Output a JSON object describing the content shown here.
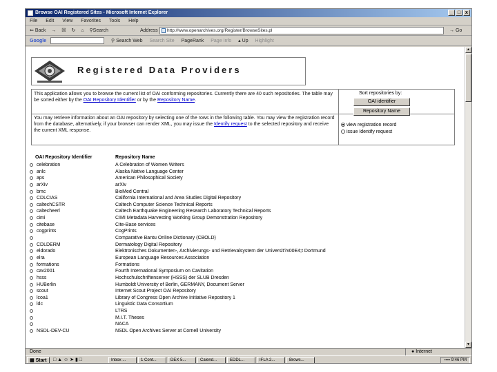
{
  "window": {
    "title": "Browse OAI Registered Sites - Microsoft Internet Explorer",
    "controls": [
      "_",
      "□",
      "x"
    ]
  },
  "menu": [
    "File",
    "Edit",
    "View",
    "Favorites",
    "Tools",
    "Help"
  ],
  "toolbar": {
    "back": "Back",
    "search": "Search",
    "address_label": "Address",
    "url": "http://www.openarchives.org/Register/BrowseSites.pl",
    "go": "Go"
  },
  "googlebar": {
    "logo": "Google",
    "search_web": "Search Web",
    "search_site": "Search Site",
    "pagerank": "PageRank",
    "page_info": "Page Info",
    "up": "Up",
    "highlight": "Highlight"
  },
  "page": {
    "title": "Registered Data Providers",
    "intro_pre": "This application allows you to browse the current list of OAI conforming repositories. Currently there are 40 such repositories. The table may be sorted either by the",
    "intro_link1": "OAI Repository Identifier",
    "intro_mid": "or by the",
    "intro_link2": "Repository Name",
    "intro_post": ".",
    "sort_label": "Sort repositories by:",
    "sort_btn1": "OAI identifier",
    "sort_btn2": "Repository Name",
    "retrieve_pre": "You may retrieve information about an OAI repository by selecting one of the rows in the following table. You may view the registration record from the database, alternatively, if your browser can render XML, you may issue the",
    "retrieve_link": "Identify request",
    "retrieve_post": "to the selected repository and receive the current XML response.",
    "opt_view": "view registration record",
    "opt_identify": "issue Identify request",
    "col_id": "OAI Repository Identifier",
    "col_name": "Repository Name"
  },
  "repositories": [
    {
      "id": "celebration",
      "name": "A Celebration of Women Writers"
    },
    {
      "id": "anlc",
      "name": "Alaska Native Language Center"
    },
    {
      "id": "aps",
      "name": "American Philosophical Society"
    },
    {
      "id": "arXiv",
      "name": "arXiv"
    },
    {
      "id": "bmc",
      "name": "BioMed Central"
    },
    {
      "id": "CDLCIAS",
      "name": "California International and Area Studies Digital Repository"
    },
    {
      "id": "caltechCSTR",
      "name": "Caltech Computer Science Technical Reports"
    },
    {
      "id": "caltecheerl",
      "name": "Caltech Earthquake Engineering Research Laboratory Technical Reports"
    },
    {
      "id": "cimi",
      "name": "CIMI Metadata Harvesting Working Group Demonstration Repository"
    },
    {
      "id": "citebase",
      "name": "Cite-Base services"
    },
    {
      "id": "cogprints",
      "name": "CogPrints"
    },
    {
      "id": "",
      "name": "Comparative Bantu Online Dictionary (CBOLD)"
    },
    {
      "id": "CDLDERM",
      "name": "Dermatology Digital Repository"
    },
    {
      "id": "eldorado",
      "name": "Elektronisches Dokumenten-, Archivierungs- und Retrievalsystem der Universit?x00E4;t Dortmund"
    },
    {
      "id": "elra",
      "name": "European Language Resources Association"
    },
    {
      "id": "formations",
      "name": "Formations"
    },
    {
      "id": "cav2001",
      "name": "Fourth International Symposium on Cavitation"
    },
    {
      "id": "hsss",
      "name": "Hochschulschriftenserver (HSSS) der SLUB Dresden"
    },
    {
      "id": "HUBerlin",
      "name": "Humboldt University of Berlin, GERMANY, Document Server"
    },
    {
      "id": "scout",
      "name": "Internet Scout Project OAI Repository"
    },
    {
      "id": "lcoa1",
      "name": "Library of Congress Open Archive Initiative Repository 1"
    },
    {
      "id": "ldc",
      "name": "Linguistic Data Consortium"
    },
    {
      "id": "",
      "name": "LTRS"
    },
    {
      "id": "",
      "name": "M.I.T. Theses"
    },
    {
      "id": "",
      "name": "NACA"
    },
    {
      "id": "NSDL-DEV-CU",
      "name": "NSDL Open Archives Server at Cornell University"
    }
  ],
  "status": {
    "text": "Done",
    "zone": "Internet"
  },
  "taskbar": {
    "start": "Start",
    "tasks": [
      "Inbox ...",
      "1 Cont...",
      "DEX 5...",
      "Calend...",
      "EDDL...",
      "IFLA 2...",
      "Brows..."
    ],
    "clock": "9:46 PM"
  }
}
